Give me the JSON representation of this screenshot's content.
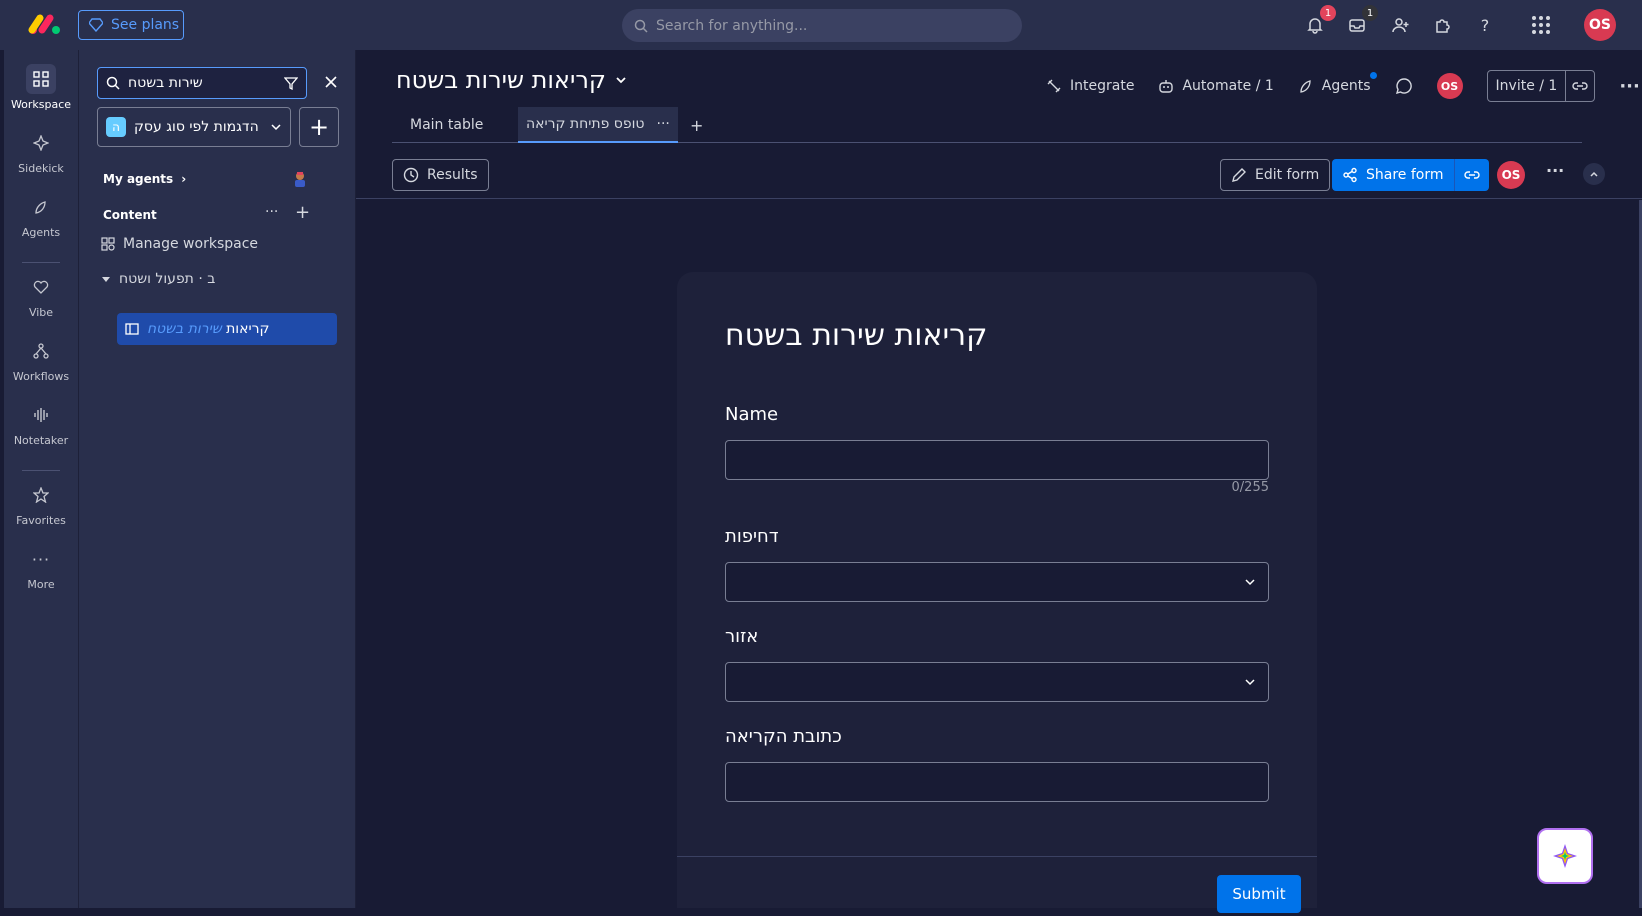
{
  "topbar": {
    "see_plans": "See plans",
    "search_placeholder": "Search for anything...",
    "notifications_count": "1",
    "inbox_count": "1",
    "user_initials": "OS"
  },
  "rail": {
    "items": [
      {
        "label": "Workspace",
        "icon": "workspace-icon"
      },
      {
        "label": "Sidekick",
        "icon": "sidekick-icon"
      },
      {
        "label": "Agents",
        "icon": "agents-icon"
      },
      {
        "label": "Vibe",
        "icon": "vibe-icon"
      },
      {
        "label": "Workflows",
        "icon": "workflows-icon"
      },
      {
        "label": "Notetaker",
        "icon": "notetaker-icon"
      },
      {
        "label": "Favorites",
        "icon": "star-icon"
      },
      {
        "label": "More",
        "icon": "more-icon"
      }
    ]
  },
  "sidebar": {
    "search_value": "שירות בשטח",
    "workspace_name": "הדגמות לפי סוג עסק",
    "workspace_initial": "ה",
    "my_agents": "My agents",
    "content": "Content",
    "manage_workspace": "Manage workspace",
    "folder": "ב · תפעול ושטח",
    "board_plain": "קריאות",
    "board_highlight": "שירות בשטח"
  },
  "board": {
    "title": "קריאות שירות בשטח",
    "integrate": "Integrate",
    "automate": "Automate / 1",
    "agents": "Agents",
    "invite": "Invite / 1",
    "tabs": [
      {
        "label": "Main table"
      },
      {
        "label": "טופס פתיחת קריאה"
      }
    ],
    "results": "Results",
    "edit_form": "Edit form",
    "share_form": "Share form"
  },
  "form": {
    "title": "קריאות שירות בשטח",
    "fields": [
      {
        "label": "Name"
      },
      {
        "label": "דחיפות"
      },
      {
        "label": "אזור"
      },
      {
        "label": "כתובת הקריאה"
      }
    ],
    "counter": "0/255",
    "submit": "Submit"
  },
  "colors": {
    "accent": "#0073ea",
    "avatar": "#d83a52",
    "background": "#181b34"
  }
}
